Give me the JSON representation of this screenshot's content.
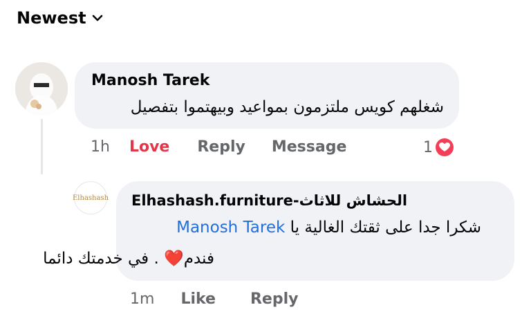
{
  "sort": {
    "label": "Newest"
  },
  "comment1": {
    "author": "Manosh Tarek",
    "text": "شغلهم كويس ملتزمون بمواعيد وبيهتموا بتفصيل",
    "time": "1h",
    "love_label": "Love",
    "reply_label": "Reply",
    "message_label": "Message",
    "reaction_count": "1",
    "reaction_color": "#f33e58"
  },
  "reply1": {
    "author": "Elhashash.furniture-الحشاش للاثاث",
    "line1_prefix": "شكرا جدا على ثقتك الغالية يا ",
    "mention": "Manosh Tarek",
    "line2": "فندم❤️ . في خدمتك دائما",
    "time": "1m",
    "like_label": "Like",
    "reply_label": "Reply",
    "avatar_logo_text": "Elhashash"
  }
}
